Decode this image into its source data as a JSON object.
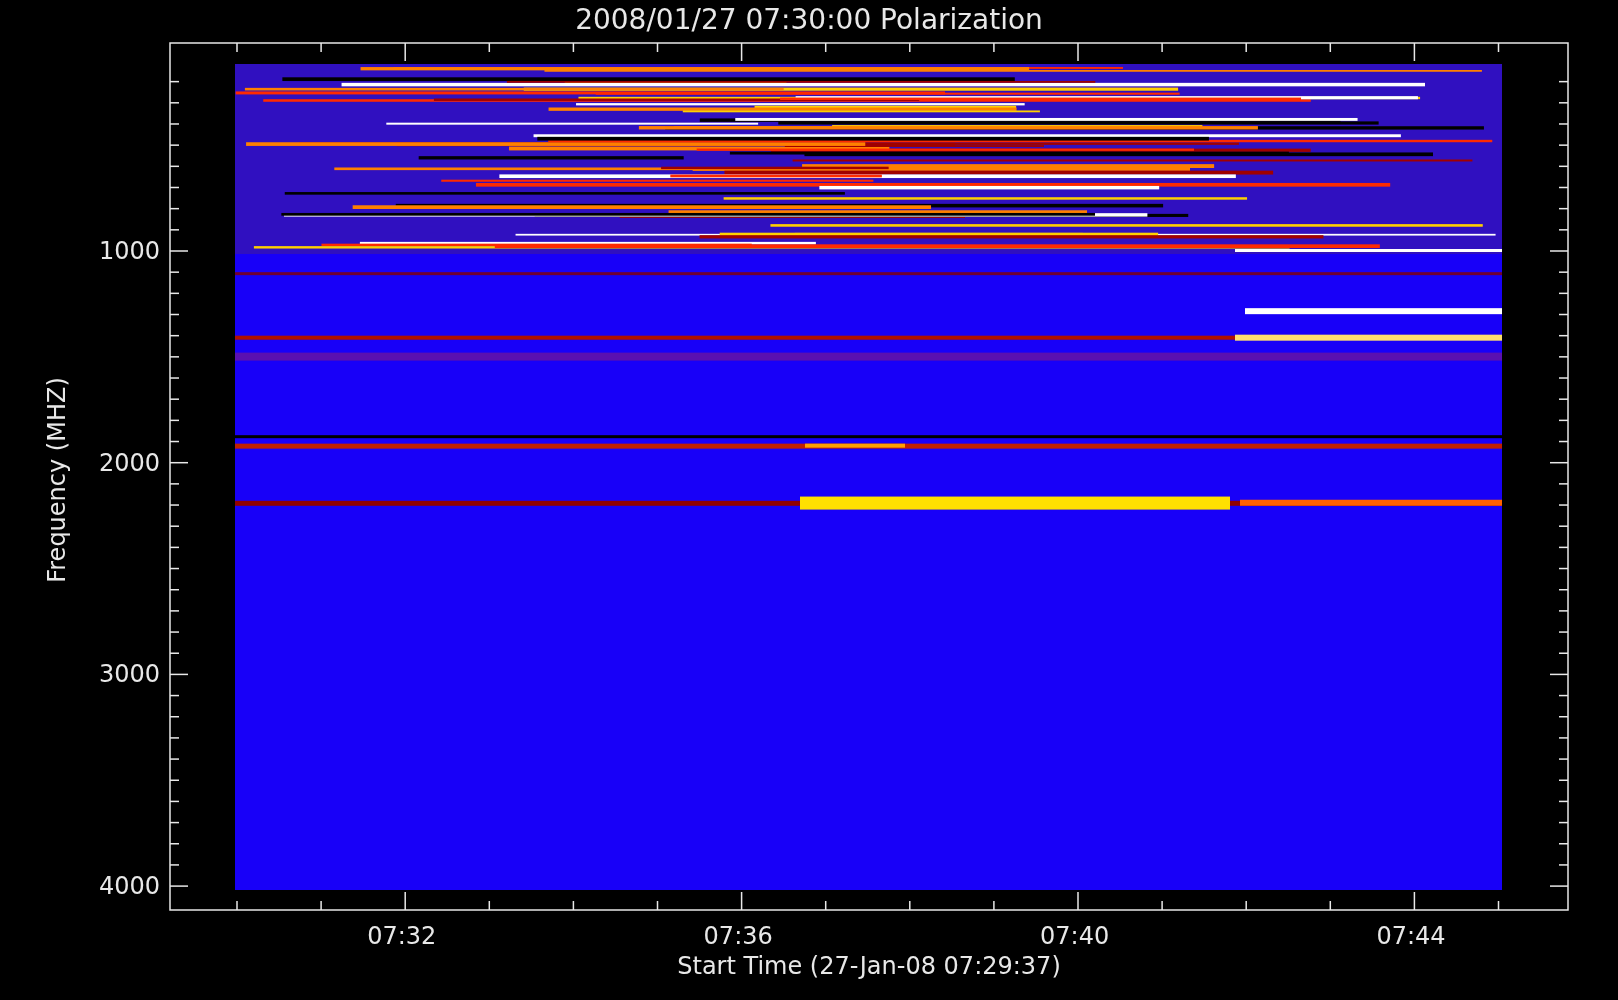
{
  "title": "2008/01/27 07:30:00 Polarization",
  "plot": {
    "ylabel": "Frequency (MHZ)",
    "xlabel": "Start Time (27-Jan-08 07:29:37)",
    "yticks": [
      "1000",
      "2000",
      "3000",
      "4000"
    ],
    "xticks": [
      "07:32",
      "07:36",
      "07:40",
      "07:44"
    ]
  }
}
